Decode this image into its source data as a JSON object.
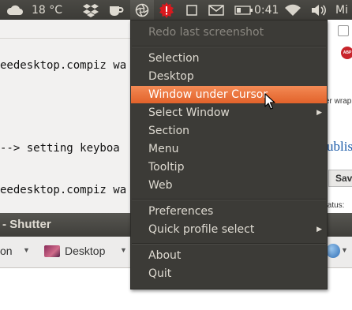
{
  "panel": {
    "weather": "18 °C",
    "clock": "0:41",
    "user": "Mi",
    "icons": [
      "cloud-icon",
      "dropbox-icon",
      "cup-icon",
      "shutter-icon",
      "update-alert-icon",
      "checkbox-icon",
      "mail-icon",
      "battery-icon",
      "wifi-icon",
      "volume-icon"
    ]
  },
  "terminal": {
    "line1": "eedesktop.compiz wa",
    "line2": "--> setting keyboa",
    "line3": "eedesktop.compiz wa"
  },
  "browser": {
    "wrap_fragment": "er wrap",
    "publish_fragment": "ublis",
    "save_fragment": "Sav",
    "status_fragment": "tatus:",
    "abp_label": "ABP"
  },
  "shutter": {
    "title": "- Shutter",
    "toolbar_left": "on",
    "toolbar_desktop": "Desktop"
  },
  "menu": {
    "redo": "Redo last screenshot",
    "items": [
      {
        "label": "Selection"
      },
      {
        "label": "Desktop"
      },
      {
        "label": "Window under Cursor"
      },
      {
        "label": "Select Window"
      },
      {
        "label": "Section"
      },
      {
        "label": "Menu"
      },
      {
        "label": "Tooltip"
      },
      {
        "label": "Web"
      }
    ],
    "preferences": "Preferences",
    "quick_profile": "Quick profile select",
    "about": "About",
    "quit": "Quit"
  },
  "colors": {
    "panel_bg": "#3c3b37",
    "menu_bg": "#3c3b37",
    "highlight": "#e2622a",
    "text": "#dfdbd2"
  }
}
